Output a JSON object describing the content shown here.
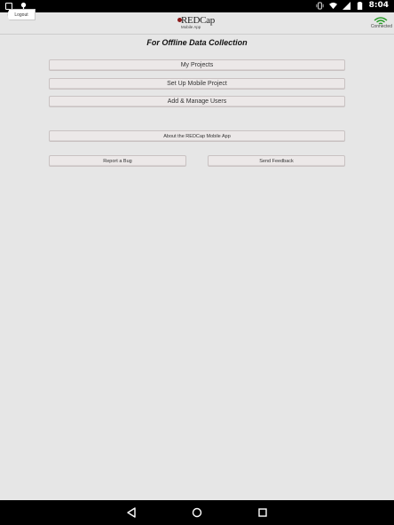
{
  "status_bar": {
    "time": "8:04",
    "icons": [
      "image-icon",
      "bolt-icon",
      "vibrate-icon",
      "wifi-icon",
      "signal-icon",
      "battery-icon"
    ]
  },
  "header": {
    "logout_label": "Logout",
    "logo_main": "REDCap",
    "logo_sub": "Mobile App",
    "connection_status": "Connected"
  },
  "main": {
    "tagline": "For Offline Data Collection",
    "buttons": {
      "my_projects": "My Projects",
      "setup_project": "Set Up Mobile Project",
      "manage_users": "Add & Manage Users",
      "about": "About the REDCap Mobile App",
      "report_bug": "Report a Bug",
      "send_feedback": "Send Feedback"
    }
  },
  "navigation": {
    "icons": [
      "back-icon",
      "home-icon",
      "recents-icon"
    ]
  },
  "colors": {
    "background": "#e6e6e6",
    "button": "#ece8e8",
    "logo_accent": "#8b1a1a",
    "wifi_green": "#2a9d2a"
  }
}
